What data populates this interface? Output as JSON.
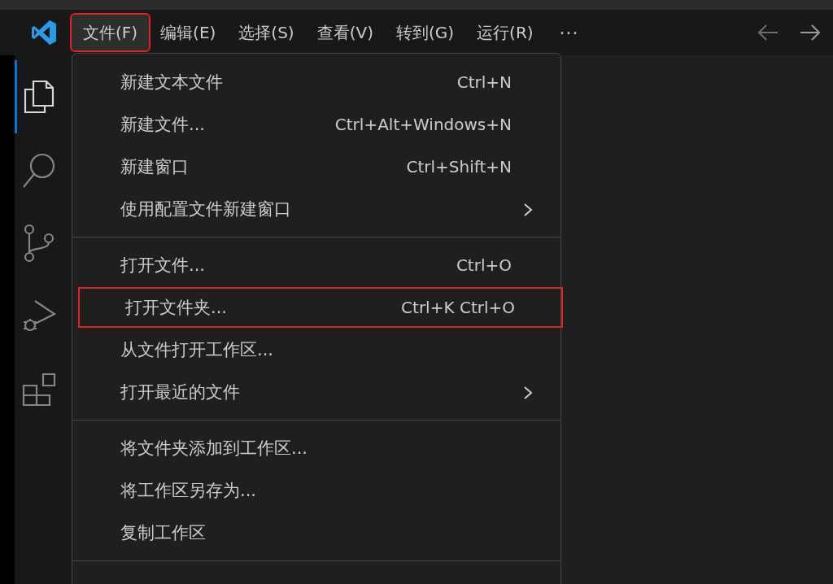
{
  "menu_bar": {
    "items": [
      {
        "label": "文件(F)",
        "selected": true,
        "annotated": true
      },
      {
        "label": "编辑(E)",
        "selected": false,
        "annotated": false
      },
      {
        "label": "选择(S)",
        "selected": false,
        "annotated": false
      },
      {
        "label": "查看(V)",
        "selected": false,
        "annotated": false
      },
      {
        "label": "转到(G)",
        "selected": false,
        "annotated": false
      },
      {
        "label": "运行(R)",
        "selected": false,
        "annotated": false
      }
    ],
    "more": "···"
  },
  "activity_bar": [
    {
      "kind": "explorer",
      "selected": true
    },
    {
      "kind": "search",
      "selected": false
    },
    {
      "kind": "source-control",
      "selected": false
    },
    {
      "kind": "run-debug",
      "selected": false
    },
    {
      "kind": "extensions",
      "selected": false
    }
  ],
  "file_menu": {
    "groups": [
      {
        "items": [
          {
            "label": "新建文本文件",
            "shortcut": "Ctrl+N",
            "submenu": false,
            "annotated": false
          },
          {
            "label": "新建文件...",
            "shortcut": "Ctrl+Alt+Windows+N",
            "submenu": false,
            "annotated": false
          },
          {
            "label": "新建窗口",
            "shortcut": "Ctrl+Shift+N",
            "submenu": false,
            "annotated": false
          },
          {
            "label": "使用配置文件新建窗口",
            "submenu": true,
            "annotated": false
          }
        ]
      },
      {
        "items": [
          {
            "label": "打开文件...",
            "shortcut": "Ctrl+O",
            "submenu": false,
            "annotated": false
          },
          {
            "label": "打开文件夹...",
            "shortcut": "Ctrl+K Ctrl+O",
            "submenu": false,
            "annotated": true
          },
          {
            "label": "从文件打开工作区...",
            "submenu": false,
            "annotated": false
          },
          {
            "label": "打开最近的文件",
            "submenu": true,
            "annotated": false
          }
        ]
      },
      {
        "items": [
          {
            "label": "将文件夹添加到工作区...",
            "submenu": false,
            "annotated": false
          },
          {
            "label": "将工作区另存为...",
            "submenu": false,
            "annotated": false
          },
          {
            "label": "复制工作区",
            "submenu": false,
            "annotated": false
          }
        ]
      }
    ]
  }
}
